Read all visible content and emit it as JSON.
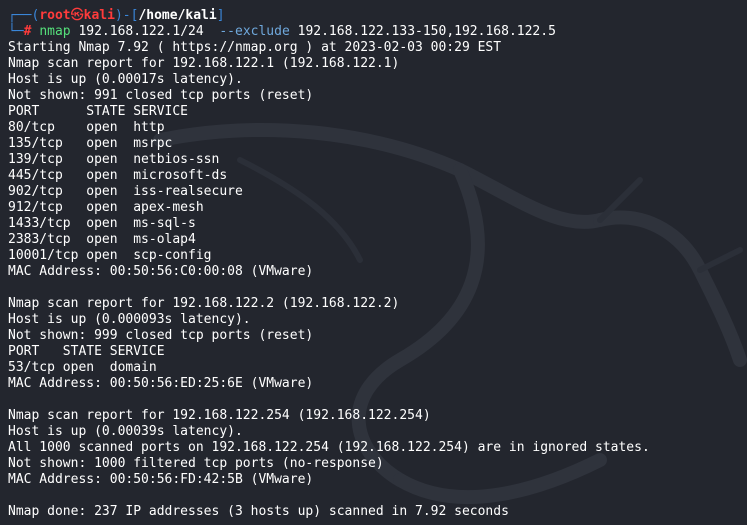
{
  "prompt": {
    "prefix": "┌──(",
    "user": "root",
    "at": "㉿",
    "host": "kali",
    "mid": ")-[",
    "path": "/home/kali",
    "suffix": "]",
    "second_prefix": "└─",
    "hash": "#",
    "command": "nmap",
    "target": "192.168.122.1/24",
    "option": "--exclude",
    "option_value": "192.168.122.133-150,192.168.122.5"
  },
  "output_lines": [
    "Starting Nmap 7.92 ( https://nmap.org ) at 2023-02-03 00:29 EST",
    "Nmap scan report for 192.168.122.1 (192.168.122.1)",
    "Host is up (0.00017s latency).",
    "Not shown: 991 closed tcp ports (reset)",
    "PORT      STATE SERVICE",
    "80/tcp    open  http",
    "135/tcp   open  msrpc",
    "139/tcp   open  netbios-ssn",
    "445/tcp   open  microsoft-ds",
    "902/tcp   open  iss-realsecure",
    "912/tcp   open  apex-mesh",
    "1433/tcp  open  ms-sql-s",
    "2383/tcp  open  ms-olap4",
    "10001/tcp open  scp-config",
    "MAC Address: 00:50:56:C0:00:08 (VMware)",
    "",
    "Nmap scan report for 192.168.122.2 (192.168.122.2)",
    "Host is up (0.000093s latency).",
    "Not shown: 999 closed tcp ports (reset)",
    "PORT   STATE SERVICE",
    "53/tcp open  domain",
    "MAC Address: 00:50:56:ED:25:6E (VMware)",
    "",
    "Nmap scan report for 192.168.122.254 (192.168.122.254)",
    "Host is up (0.00039s latency).",
    "All 1000 scanned ports on 192.168.122.254 (192.168.122.254) are in ignored states.",
    "Not shown: 1000 filtered tcp ports (no-response)",
    "MAC Address: 00:50:56:FD:42:5B (VMware)",
    "",
    "Nmap done: 237 IP addresses (3 hosts up) scanned in 7.92 seconds"
  ],
  "colors": {
    "background": "#23262e",
    "prompt_frame": "#3a86d8",
    "prompt_user": "#ff3b3b",
    "command": "#55e07b",
    "option": "#6fa8dc",
    "text": "#ffffff"
  }
}
